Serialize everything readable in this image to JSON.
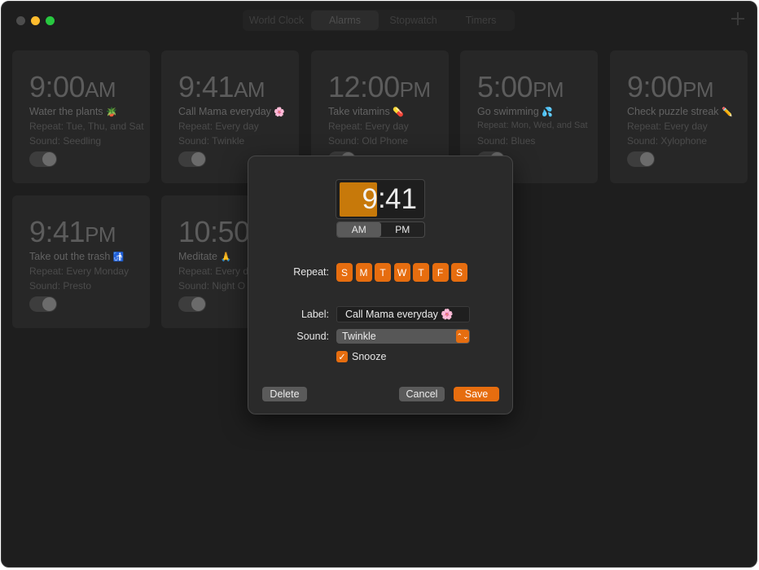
{
  "titlebar": {
    "tabs": [
      {
        "label": "World Clock",
        "active": false
      },
      {
        "label": "Alarms",
        "active": true
      },
      {
        "label": "Stopwatch",
        "active": false
      },
      {
        "label": "Timers",
        "active": false
      }
    ],
    "add_icon": "plus-icon"
  },
  "alarms": [
    {
      "time": "9:00",
      "ampm": "AM",
      "label": "Water the plants",
      "emoji": "🪴",
      "repeat": "Repeat: Tue, Thu, and Sat",
      "sound": "Sound: Seedling"
    },
    {
      "time": "9:41",
      "ampm": "AM",
      "label": "Call Mama everyday",
      "emoji": "🌸",
      "repeat": "Repeat: Every day",
      "sound": "Sound: Twinkle"
    },
    {
      "time": "12:00",
      "ampm": "PM",
      "label": "Take vitamins",
      "emoji": "💊",
      "repeat": "Repeat: Every day",
      "sound": "Sound: Old Phone"
    },
    {
      "time": "5:00",
      "ampm": "PM",
      "label": "Go swimming",
      "emoji": "💦",
      "repeat": "Repeat: Mon, Wed, and Sat",
      "sound": "Sound: Blues"
    },
    {
      "time": "9:00",
      "ampm": "PM",
      "label": "Check puzzle streak",
      "emoji": "✏️",
      "repeat": "Repeat: Every day",
      "sound": "Sound: Xylophone"
    },
    {
      "time": "9:41",
      "ampm": "PM",
      "label": "Take out the trash",
      "emoji": "🚮",
      "repeat": "Repeat: Every Monday",
      "sound": "Sound: Presto"
    },
    {
      "time": "10:50",
      "ampm": "",
      "label": "Meditate",
      "emoji": "🙏",
      "repeat": "Repeat: Every d",
      "sound": "Sound: Night O"
    }
  ],
  "dialog": {
    "hour": "9",
    "colon": ":",
    "minute": "41",
    "am_label": "AM",
    "pm_label": "PM",
    "selected_period": "AM",
    "repeat_label": "Repeat:",
    "days": [
      "S",
      "M",
      "T",
      "W",
      "T",
      "F",
      "S"
    ],
    "label_label": "Label:",
    "label_value": "Call Mama everyday 🌸",
    "sound_label": "Sound:",
    "sound_value": "Twinkle",
    "sound_stepper": "⌃⌄",
    "snooze_label": "Snooze",
    "snooze_checked": "✓",
    "delete_label": "Delete",
    "cancel_label": "Cancel",
    "save_label": "Save"
  },
  "colors": {
    "accent": "#e66d0f",
    "hour_highlight": "#c7790a",
    "window_bg": "#1e1e1e",
    "card_bg": "#272727"
  }
}
